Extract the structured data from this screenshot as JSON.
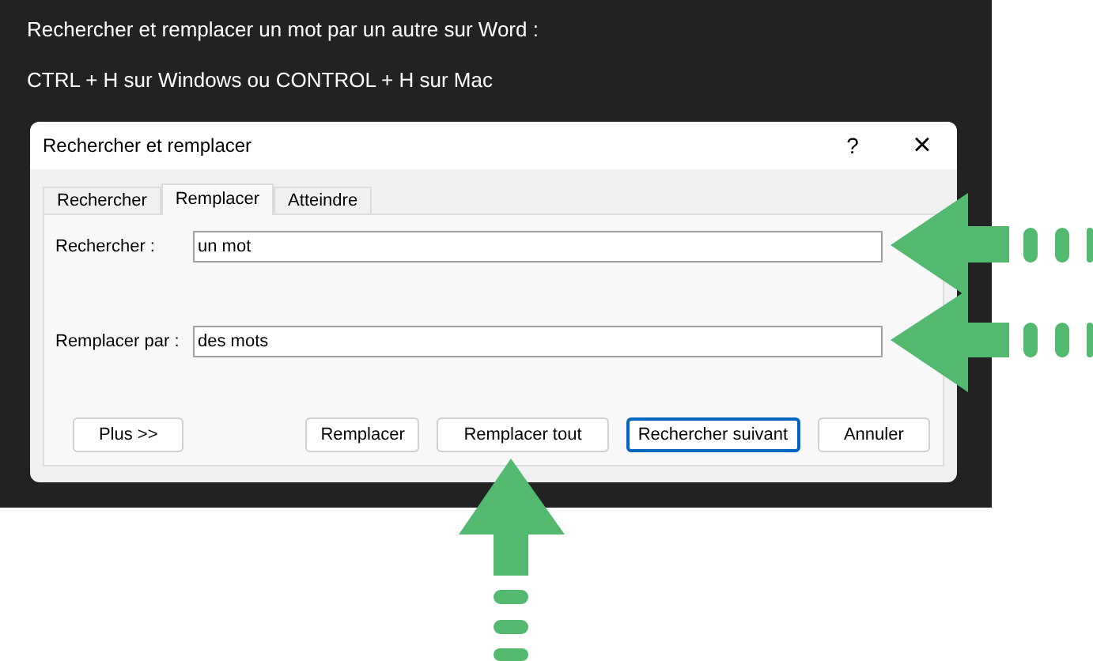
{
  "document": {
    "lines": [
      "Rechercher et remplacer un mot par un autre sur Word :",
      "CTRL + H sur Windows ou CONTROL + H sur Mac"
    ]
  },
  "dialog": {
    "title": "Rechercher et remplacer",
    "help": "?",
    "close": "×",
    "tabs": [
      {
        "label": "Rechercher",
        "selected": false
      },
      {
        "label": "Remplacer",
        "selected": true
      },
      {
        "label": "Atteindre",
        "selected": false
      }
    ],
    "fields": [
      {
        "label": "Rechercher :",
        "value": "un mot"
      },
      {
        "label": "Remplacer par :",
        "value": "des mots"
      }
    ],
    "buttons": [
      {
        "label": "Plus >>",
        "default": false
      },
      {
        "label": "Remplacer",
        "default": false
      },
      {
        "label": "Remplacer tout",
        "default": false
      },
      {
        "label": "Rechercher suivant",
        "default": true
      },
      {
        "label": "Annuler",
        "default": false
      }
    ]
  }
}
